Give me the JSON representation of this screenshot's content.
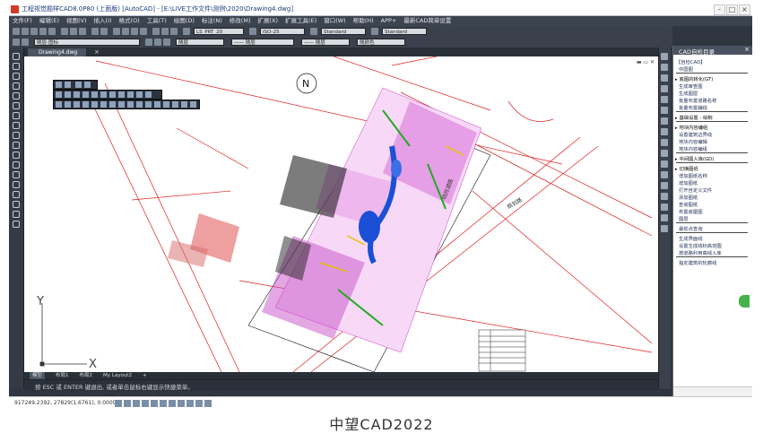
{
  "window": {
    "title": "工程视觉题样CAD8.0P80 (上面版) [AutoCAD] - [E:\\LIVE工作文件\\测例\\2020\\Drawing4.dwg]",
    "controls": [
      "-",
      "□",
      "×"
    ]
  },
  "menu": [
    "文件(F)",
    "编辑(E)",
    "视图(V)",
    "插入(I)",
    "格式(O)",
    "工具(T)",
    "绘图(D)",
    "标注(N)",
    "修改(M)",
    "扩展(X)",
    "扩展工具(E)",
    "窗口(W)",
    "帮助(H)",
    "APP+",
    "最新CAD简单设置"
  ],
  "toolbar": {
    "layer": "LS_PRT_20",
    "scale": "ISO-25",
    "style1": "Standard",
    "style2": "Standard",
    "linetype_layer": "随层-图标",
    "bylayer1": "随层",
    "bylayer2": "—— 随层",
    "bylayer3": "—— 随层",
    "bylayer4": "随颜色"
  },
  "document_tab": "Drawing4.dwg",
  "layout_tabs": [
    "模型",
    "布局1",
    "布局2",
    "My Layout2",
    "+"
  ],
  "command_prompt": "按 ESC 或 ENTER 键退出, 或者单击鼠标右键显示快捷菜单。",
  "status": {
    "coordinates": "917249.2392, 27829(1.6761), 0.0000"
  },
  "canvas": {
    "north_label": "N",
    "ucs_x": "X",
    "ucs_y": "Y",
    "road_label_1": "明月湖路",
    "road_label_2": "规划路"
  },
  "panel": {
    "title": "CAD自检目录",
    "close": "×",
    "sections": [
      {
        "label": "【自检CAD】",
        "type": "header"
      },
      {
        "label": "中国图",
        "type": "item"
      },
      {
        "label": "底图的转化(GT)",
        "type": "section"
      },
      {
        "label": "生成审查图",
        "type": "item"
      },
      {
        "label": "生成图层",
        "type": "item"
      },
      {
        "label": "批量布置道路名称",
        "type": "item"
      },
      {
        "label": "批量布置辅线",
        "type": "item"
      },
      {
        "label": "基础设置 - 绘制",
        "type": "section"
      },
      {
        "label": "地块内容编组",
        "type": "section"
      },
      {
        "label": "设置建筑边界线",
        "type": "item"
      },
      {
        "label": "地块内容编辑",
        "type": "item"
      },
      {
        "label": "地块内容编组",
        "type": "item"
      },
      {
        "label": "中间图入库(GD)",
        "type": "section"
      },
      {
        "label": "切换图纸",
        "type": "section"
      },
      {
        "label": "增加图纸名称",
        "type": "item"
      },
      {
        "label": "增加图纸",
        "type": "item"
      },
      {
        "label": "打开自定义文件",
        "type": "item"
      },
      {
        "label": "添加图纸",
        "type": "item"
      },
      {
        "label": "查询图纸",
        "type": "item"
      },
      {
        "label": "布置房屋图",
        "type": "item"
      },
      {
        "label": "图层",
        "type": "item"
      },
      {
        "label": "最低点查询",
        "type": "item"
      },
      {
        "label": "生成界面线",
        "type": "item"
      },
      {
        "label": "设置生成线标高范围",
        "type": "item"
      },
      {
        "label": "按道路利用高线入库",
        "type": "item"
      },
      {
        "label": "指定建筑的轮廓线",
        "type": "item"
      }
    ]
  },
  "caption": "中望CAD2022",
  "colors": {
    "chrome": "#2f3640",
    "canvas_bg": "#ffffff",
    "road_red": "#e02020",
    "building_magenta": "#cc33cc",
    "water_blue": "#1a4fd6",
    "tree_green": "#22aa22"
  }
}
